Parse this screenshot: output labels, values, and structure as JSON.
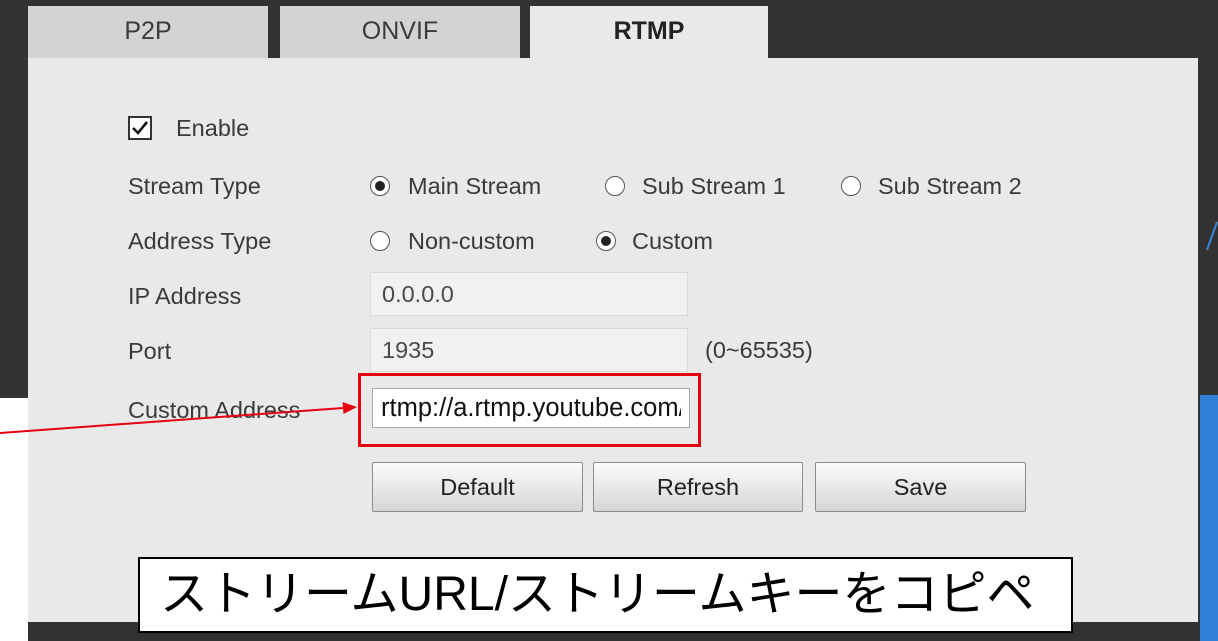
{
  "tabs": [
    {
      "label": "P2P",
      "active": false
    },
    {
      "label": "ONVIF",
      "active": false
    },
    {
      "label": "RTMP",
      "active": true
    }
  ],
  "form": {
    "enable": {
      "label": "Enable",
      "checked": true
    },
    "stream_type": {
      "label": "Stream Type",
      "options": [
        {
          "label": "Main Stream",
          "selected": true
        },
        {
          "label": "Sub Stream 1",
          "selected": false
        },
        {
          "label": "Sub Stream 2",
          "selected": false
        }
      ]
    },
    "address_type": {
      "label": "Address Type",
      "options": [
        {
          "label": "Non-custom",
          "selected": false
        },
        {
          "label": "Custom",
          "selected": true
        }
      ]
    },
    "ip_address": {
      "label": "IP Address",
      "value": "0.0.0.0"
    },
    "port": {
      "label": "Port",
      "value": "1935",
      "range_hint": "(0~65535)"
    },
    "custom_address": {
      "label": "Custom Address",
      "value": "rtmp://a.rtmp.youtube.com/"
    }
  },
  "buttons": {
    "default": "Default",
    "refresh": "Refresh",
    "save": "Save"
  },
  "annotation": {
    "text": "ストリームURL/ストリームキーをコピペ"
  },
  "colors": {
    "background": "#323232",
    "panel": "#e9e9e9",
    "tab_inactive": "#d3d3d3",
    "highlight": "#e60012",
    "accent_blue": "#2f7fd6"
  }
}
